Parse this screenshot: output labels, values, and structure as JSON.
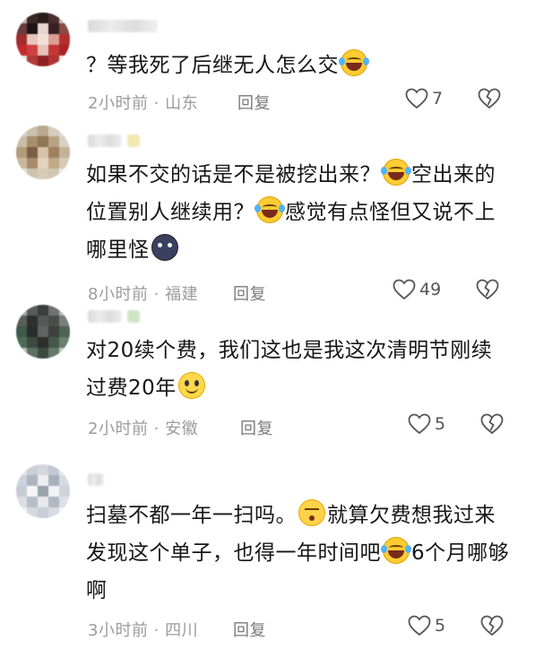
{
  "comments": [
    {
      "segments": [
        "？等我死了后继无人怎么交"
      ],
      "emojis": [
        "crying-laughing-emoji"
      ],
      "time": "2小时前 · 山东",
      "reply": "回复",
      "likes": "7"
    },
    {
      "segments": [
        "如果不交的话是不是被挖出来？",
        "空出来的位置别人继续用？",
        "感觉有点怪但又说不上哪里怪"
      ],
      "emojis": [
        "crying-laughing-emoji",
        "crying-laughing-emoji",
        "dark-moon-emoji"
      ],
      "time": "8小时前 · 福建",
      "reply": "回复",
      "likes": "49"
    },
    {
      "segments": [
        "对20续个费，我们这也是我这次清明节刚续过费20年"
      ],
      "emojis": [
        "smiling-emoji"
      ],
      "time": "2小时前 · 安徽",
      "reply": "回复",
      "likes": "5"
    },
    {
      "segments": [
        "扫墓不都一年一扫吗。",
        "就算欠费想我过来发现这个单子，也得一年时间吧",
        "6个月哪够啊"
      ],
      "emojis": [
        "sighing-emoji",
        "crying-laughing-emoji"
      ],
      "time": "3小时前 · 四川",
      "reply": "回复",
      "likes": "5"
    }
  ],
  "colors": {
    "text": "#161616",
    "meta": "#9c9c9c",
    "icon": "#555555"
  }
}
